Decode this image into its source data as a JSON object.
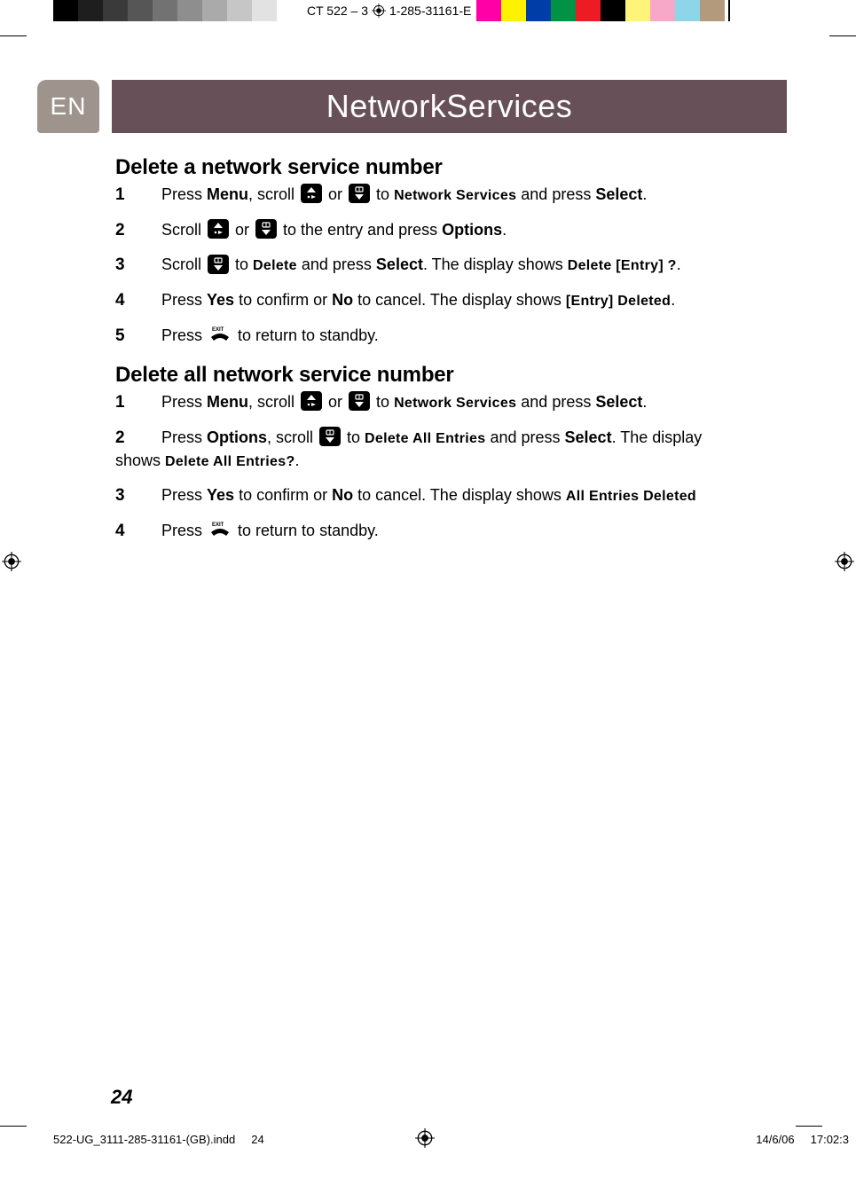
{
  "header": {
    "doc_code_left": "CT 522  –   3",
    "doc_code_right": "1-285-31161-E",
    "lang": "EN",
    "title_a": "Network",
    "title_b": " Services"
  },
  "section1": {
    "title": "Delete a network service number",
    "step1": {
      "num": "1",
      "t1": "Press ",
      "menu": "Menu",
      "t2": ", scroll ",
      "or": " or ",
      "t3": " to ",
      "target": "Network Services",
      "t4": "  and press ",
      "select": "Select",
      "dot": "."
    },
    "step2": {
      "num": "2",
      "t1": "Scroll ",
      "or": " or ",
      "t2": " to the entry and press ",
      "options": "Options",
      "dot": "."
    },
    "step3": {
      "num": "3",
      "t1": "Scroll ",
      "t2": " to ",
      "delete": "Delete",
      "t3": "  and press ",
      "select": "Select",
      "t4": ". The display shows ",
      "prompt": "Delete [Entry] ?",
      "dot": "."
    },
    "step4": {
      "num": "4",
      "t1": "Press ",
      "yes": "Yes",
      "t2": " to confirm or ",
      "no": "No",
      "t3": " to cancel. The display shows ",
      "result": "[Entry] Deleted",
      "dot": "."
    },
    "step5": {
      "num": "5",
      "t1": "Press ",
      "t2": " to return to standby."
    }
  },
  "section2": {
    "title": "Delete all network service number",
    "step1": {
      "num": "1",
      "t1": "Press ",
      "menu": "Menu",
      "t2": ", scroll ",
      "or": " or ",
      "t3": " to ",
      "target": "Network Services",
      "t4": "  and press ",
      "select": "Select",
      "dot": "."
    },
    "step2": {
      "num": "2",
      "t1": "Press ",
      "options": "Options",
      "t2": ", scroll ",
      "t3": " to ",
      "target": "Delete All Entries",
      "t4": "  and press ",
      "select": "Select",
      "t5": ". The display",
      "cont": "shows ",
      "prompt": "Delete All Entries?",
      "dot2": "."
    },
    "step3": {
      "num": "3",
      "t1": "Press ",
      "yes": "Yes",
      "t2": " to confirm or ",
      "no": "No",
      "t3": " to cancel. The display shows ",
      "result": "All Entries Deleted"
    },
    "step4": {
      "num": "4",
      "t1": "Press ",
      "t2": " to return to standby."
    }
  },
  "page_num": "24",
  "footer": {
    "file": "522-UG_3111-285-31161-(GB).indd",
    "page": "24",
    "date": "14/6/06",
    "time": "17:02:3"
  },
  "colors": {
    "gray1": "#000000",
    "gray2": "#1e1e1e",
    "gray3": "#3a3a3a",
    "gray4": "#565656",
    "gray5": "#727272",
    "gray6": "#8e8e8e",
    "gray7": "#aaaaaa",
    "gray8": "#c6c6c6",
    "gray9": "#e2e2e2",
    "gray10": "#ffffff",
    "magenta": "#ff00a6",
    "yellow": "#fff200",
    "blue": "#003da6",
    "green": "#009245",
    "red": "#ed1c24",
    "yellow2": "#fff47a",
    "pink": "#f7a8c9",
    "cyan": "#8fd5e8",
    "tan": "#b39a7c"
  }
}
